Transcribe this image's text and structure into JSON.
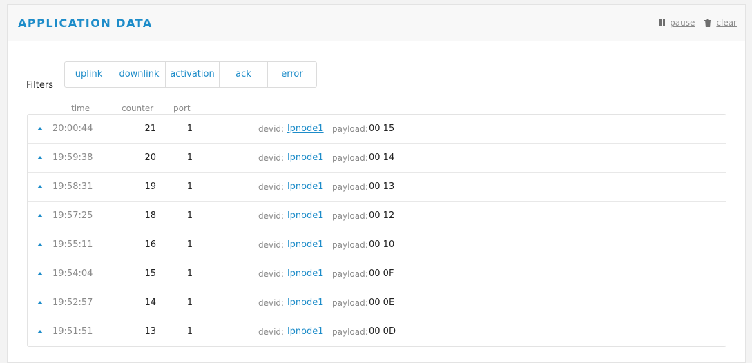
{
  "header": {
    "title": "APPLICATION DATA",
    "pause_label": "pause",
    "clear_label": "clear"
  },
  "filters": {
    "label": "Filters",
    "items": [
      "uplink",
      "downlink",
      "activation",
      "ack",
      "error"
    ]
  },
  "columns": {
    "time": "time",
    "counter": "counter",
    "port": "port"
  },
  "row_labels": {
    "devid": "devid:",
    "payload": "payload:"
  },
  "rows": [
    {
      "time": "20:00:44",
      "counter": "21",
      "port": "1",
      "devid": "lpnode1",
      "payload": "00 15"
    },
    {
      "time": "19:59:38",
      "counter": "20",
      "port": "1",
      "devid": "lpnode1",
      "payload": "00 14"
    },
    {
      "time": "19:58:31",
      "counter": "19",
      "port": "1",
      "devid": "lpnode1",
      "payload": "00 13"
    },
    {
      "time": "19:57:25",
      "counter": "18",
      "port": "1",
      "devid": "lpnode1",
      "payload": "00 12"
    },
    {
      "time": "19:55:11",
      "counter": "16",
      "port": "1",
      "devid": "lpnode1",
      "payload": "00 10"
    },
    {
      "time": "19:54:04",
      "counter": "15",
      "port": "1",
      "devid": "lpnode1",
      "payload": "00 0F"
    },
    {
      "time": "19:52:57",
      "counter": "14",
      "port": "1",
      "devid": "lpnode1",
      "payload": "00 0E"
    },
    {
      "time": "19:51:51",
      "counter": "13",
      "port": "1",
      "devid": "lpnode1",
      "payload": "00 0D"
    }
  ],
  "icons": {
    "pause": "pause-icon",
    "clear": "trash-icon",
    "expand": "caret-up-icon"
  },
  "colors": {
    "accent": "#1d8cc9",
    "muted": "#8a8a8a"
  }
}
